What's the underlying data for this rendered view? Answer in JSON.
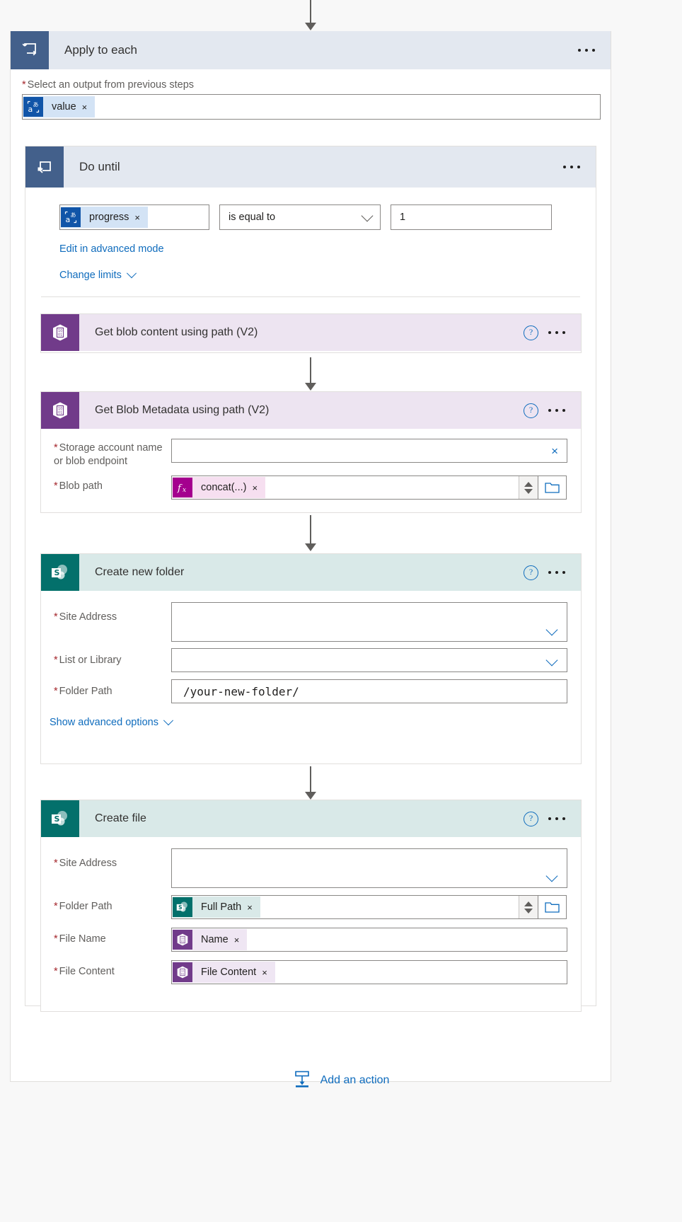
{
  "flow": {
    "apply_to_each": {
      "title": "Apply to each",
      "icon": "loop-foreach-icon",
      "menu": "ellipsis-menu",
      "output_label": "Select an output from previous steps",
      "output_token": {
        "text": "value",
        "icon": "dynamic-content-icon",
        "remove": "×"
      }
    },
    "do_until": {
      "title": "Do until",
      "icon": "loop-until-icon",
      "menu": "ellipsis-menu",
      "condition": {
        "left_token": {
          "text": "progress",
          "icon": "dynamic-content-icon",
          "remove": "×"
        },
        "operator": "is equal to",
        "right_value": "1"
      },
      "advanced_mode_link": "Edit in advanced mode",
      "change_limits_link": "Change limits"
    },
    "get_blob_content": {
      "title": "Get blob content using path (V2)",
      "icon": "azure-blob-storage-icon",
      "help": "?",
      "menu": "ellipsis-menu"
    },
    "get_blob_metadata": {
      "title": "Get Blob Metadata using path (V2)",
      "icon": "azure-blob-storage-icon",
      "help": "?",
      "menu": "ellipsis-menu",
      "fields": [
        {
          "label_line1": "Storage account name",
          "label_line2": "or blob endpoint",
          "required": true,
          "type": "text-clear",
          "value": "",
          "clear_icon": "×"
        },
        {
          "label_line1": "Blob path",
          "label_line2": "",
          "required": true,
          "type": "token-picker",
          "token": {
            "text": "concat(...)",
            "icon": "expression-fx-icon",
            "remove": "×"
          }
        }
      ]
    },
    "create_new_folder": {
      "title": "Create new folder",
      "icon": "sharepoint-icon",
      "help": "?",
      "menu": "ellipsis-menu",
      "fields": [
        {
          "label": "Site Address",
          "required": true,
          "type": "combo-tall",
          "value": ""
        },
        {
          "label": "List or Library",
          "required": true,
          "type": "combo",
          "value": ""
        },
        {
          "label": "Folder Path",
          "required": true,
          "type": "mono-text",
          "value": "/your-new-folder/"
        }
      ],
      "advanced_link": "Show advanced options"
    },
    "create_file": {
      "title": "Create file",
      "icon": "sharepoint-icon",
      "help": "?",
      "menu": "ellipsis-menu",
      "fields": [
        {
          "label": "Site Address",
          "required": true,
          "type": "combo-tall",
          "value": ""
        },
        {
          "label": "Folder Path",
          "required": true,
          "type": "token-picker",
          "token": {
            "text": "Full Path",
            "icon": "sharepoint-icon",
            "remove": "×"
          }
        },
        {
          "label": "File Name",
          "required": true,
          "type": "token",
          "token": {
            "text": "Name",
            "icon": "azure-blob-storage-icon",
            "remove": "×"
          }
        },
        {
          "label": "File Content",
          "required": true,
          "type": "token",
          "token": {
            "text": "File Content",
            "icon": "azure-blob-storage-icon",
            "remove": "×"
          }
        }
      ]
    },
    "add_action": {
      "label": "Add an action",
      "icon": "add-action-icon"
    }
  },
  "colors": {
    "loop_header_bg": "#e3e8f0",
    "loop_icon_bg": "#43608b",
    "blob_header_bg": "#ede4f1",
    "blob_icon_bg": "#713b8a",
    "sharepoint_header_bg": "#d9e9e8",
    "sharepoint_icon_bg": "#03706b",
    "link_blue": "#0f6cbd",
    "required_red": "#a4262c"
  }
}
